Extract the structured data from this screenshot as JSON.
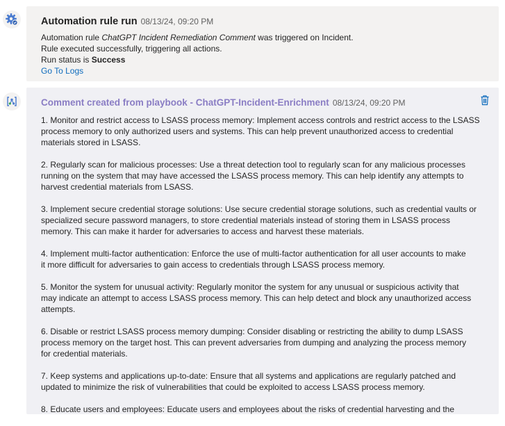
{
  "run": {
    "title": "Automation rule run",
    "timestamp": "08/13/24, 09:20 PM",
    "line1_pre": "Automation rule ",
    "rule_name": "ChatGPT Incident Remediation Comment",
    "line1_post": " was triggered on Incident.",
    "line2": "Rule executed successfully, triggering all actions.",
    "status_pre": "Run status is ",
    "status_value": "Success",
    "logs_link": "Go To Logs",
    "icon": "gear-icon"
  },
  "comment": {
    "title": "Comment created from playbook - ChatGPT-Incident-Enrichment",
    "timestamp": "08/13/24, 09:20 PM",
    "icon": "playbook-icon",
    "delete_icon": "trash-icon",
    "accent_color": "#8a7dc4",
    "paragraphs": [
      [
        "1. Monitor and restrict access to LSASS process memory: Implement access controls and restrict access to the LSASS",
        "process memory to only authorized users and systems. This can help prevent unauthorized access to credential",
        "materials stored in LSASS."
      ],
      [
        "2. Regularly scan for malicious processes: Use a threat detection tool to regularly scan for any malicious processes",
        "running on the system that may have accessed the LSASS process memory. This can help identify any attempts to",
        "harvest credential materials from LSASS."
      ],
      [
        "3. Implement secure credential storage solutions: Use secure credential storage solutions, such as credential vaults or",
        "specialized secure password managers, to store credential materials instead of storing them in LSASS process",
        "memory. This can make it harder for adversaries to access and harvest these materials."
      ],
      [
        "4. Implement multi-factor authentication: Enforce the use of multi-factor authentication for all user accounts to make",
        "it more difficult for adversaries to gain access to credentials through LSASS process memory."
      ],
      [
        "5. Monitor the system for unusual activity: Regularly monitor the system for any unusual or suspicious activity that",
        "may indicate an attempt to access LSASS process memory. This can help detect and block any unauthorized access",
        "attempts."
      ],
      [
        "6. Disable or restrict LSASS process memory dumping: Consider disabling or restricting the ability to dump LSASS",
        "process memory on the target host. This can prevent adversaries from dumping and analyzing the process memory",
        "for credential materials."
      ],
      [
        "7. Keep systems and applications up-to-date: Ensure that all systems and applications are regularly patched and",
        "updated to minimize the risk of vulnerabilities that could be exploited to access LSASS process memory."
      ],
      [
        "8. Educate users and employees: Educate users and employees about the risks of credential harvesting and the"
      ]
    ]
  }
}
